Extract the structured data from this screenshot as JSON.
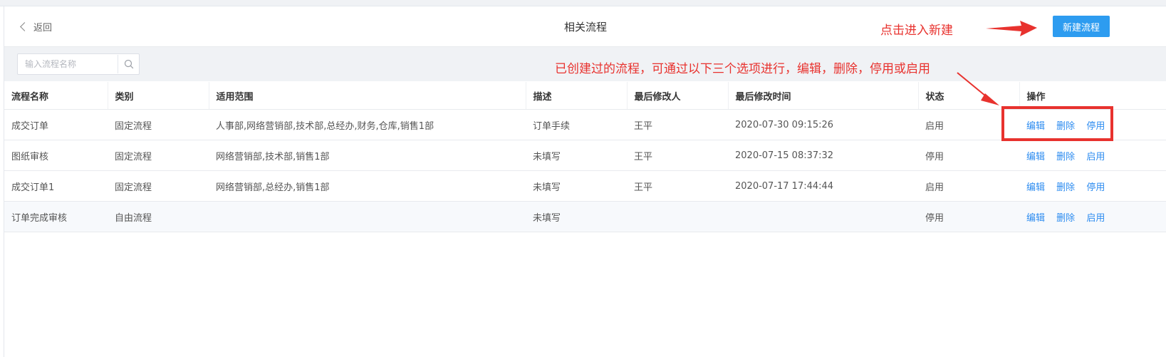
{
  "header": {
    "back_label": "返回",
    "title": "相关流程",
    "new_button_label": "新建流程"
  },
  "annotations": {
    "new_hint": "点击进入新建",
    "ops_hint": "已创建过的流程，可通过以下三个选项进行，编辑，删除，停用或启用",
    "color": "#e8322e"
  },
  "search": {
    "placeholder": "输入流程名称",
    "icon": "search-icon"
  },
  "table": {
    "columns": [
      "流程名称",
      "类别",
      "适用范围",
      "描述",
      "最后修改人",
      "最后修改时间",
      "状态",
      "操作"
    ],
    "rows": [
      {
        "name": "成交订单",
        "category": "固定流程",
        "scope": "人事部,网络营销部,技术部,总经办,财务,仓库,销售1部",
        "desc": "订单手续",
        "modifier": "王平",
        "time": "2020-07-30 09:15:26",
        "status": "启用",
        "ops": [
          "编辑",
          "删除",
          "停用"
        ]
      },
      {
        "name": "图纸审核",
        "category": "固定流程",
        "scope": "网络营销部,技术部,销售1部",
        "desc": "未填写",
        "modifier": "王平",
        "time": "2020-07-15 08:37:32",
        "status": "停用",
        "ops": [
          "编辑",
          "删除",
          "启用"
        ]
      },
      {
        "name": "成交订单1",
        "category": "固定流程",
        "scope": "网络营销部,总经办,销售1部",
        "desc": "未填写",
        "modifier": "王平",
        "time": "2020-07-17 17:44:44",
        "status": "启用",
        "ops": [
          "编辑",
          "删除",
          "停用"
        ]
      },
      {
        "name": "订单完成审核",
        "category": "自由流程",
        "scope": "",
        "desc": "未填写",
        "modifier": "",
        "time": "",
        "status": "停用",
        "ops": [
          "编辑",
          "删除",
          "启用"
        ]
      }
    ]
  },
  "colors": {
    "primary": "#2d9cf0",
    "link": "#2d8cf0",
    "annotation": "#e8322e",
    "toolbar_bg": "#f0f2f5"
  }
}
